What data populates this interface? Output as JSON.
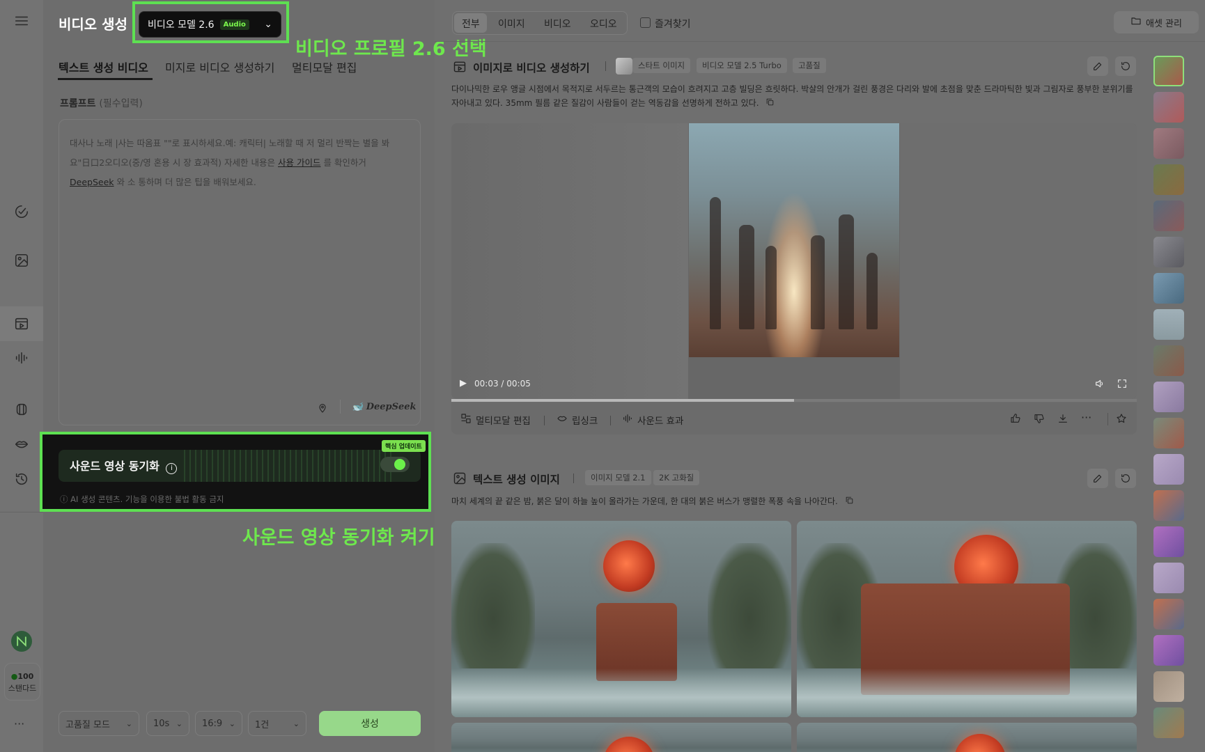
{
  "app": {
    "title": "비디오 생성",
    "model_select": {
      "label": "비디오 모델 2.6",
      "badge": "Audio"
    }
  },
  "annotations": {
    "model": "비디오 프로필 2.6 선택",
    "sound": "사운드 영상 동기화 켜기"
  },
  "left": {
    "tabs": [
      "텍스트 생성 비디오",
      "미지로 비디오 생성하기",
      "멀티모달 편집"
    ],
    "prompt": {
      "label": "프롬프트",
      "required": "(필수입력)",
      "placeholder_1": "대사나 노래 |사는 따옴표 \"\"로 표시하세요.예: 캐릭터| 노래할 때 저 멀리 반짝는 별을 봐",
      "placeholder_2a": "요\"日口2오디오(중/영 혼용 시 장 효과적) 자세한 내용은 ",
      "placeholder_link1": "사용 가이드",
      "placeholder_2b": " 를 확인하거",
      "placeholder_link2": "DeepSeek",
      "placeholder_3": " 와 소 통하며 더 많은 팁을 배워보세요.",
      "deepseek_label": "DeepSeek"
    },
    "sound_sync": {
      "title": "사운드 영상 동기화",
      "badge": "핵심 업데이트",
      "enabled": true,
      "disclaimer": "AI 생성 콘텐츠. 기능을 이용한 불법 활동 금지"
    },
    "controls": {
      "quality": "고품질 모드",
      "duration": "10s",
      "ratio": "16:9",
      "count": "1건",
      "generate": "생성"
    },
    "credits": {
      "amount": "100",
      "plan": "스탠다드"
    },
    "more": "···"
  },
  "filters": {
    "items": [
      "전부",
      "이미지",
      "비디오",
      "오디오"
    ],
    "active": "전부",
    "favorites": "즐겨찾기",
    "asset_button": "애셋 관리"
  },
  "video_card": {
    "title": "이미지로 비디오 생성하기",
    "chips": [
      "스타트 이미지",
      "비디오 모델 2.5 Turbo",
      "고품질"
    ],
    "description": "다이나믹한 로우 앵글 시점에서 목적지로 서두르는 통근객의 모습이 흐려지고 고층 빌딩은 흐릿하다. 박살의 안개가 걸린 풍경은 다리와 발에 초점을 맞춘 드라마틱한 빛과 그림자로 풍부한 분위기를 자아내고 있다. 35mm 필름 같은 질감이 사람들이 걷는 역동감을 선명하게 전하고 있다.",
    "time_current": "00:03",
    "time_total": "00:05",
    "progress": 0.5,
    "actions": [
      "멀티모달 편집",
      "립싱크",
      "사운드 효과"
    ]
  },
  "image_card": {
    "title": "텍스트 생성 이미지",
    "chips": [
      "이미지 모델 2.1",
      "2K 고화질"
    ],
    "description": "마치 세계의 끝 같은 밤, 붉은 달이 하늘 높이 올라가는 가운데, 한 대의 붉은 버스가 맹렬한 폭풍 속을 나아간다."
  },
  "colors": {
    "accent": "#5ee052",
    "highlight": "#6ee84d",
    "generate": "#97d88a"
  }
}
